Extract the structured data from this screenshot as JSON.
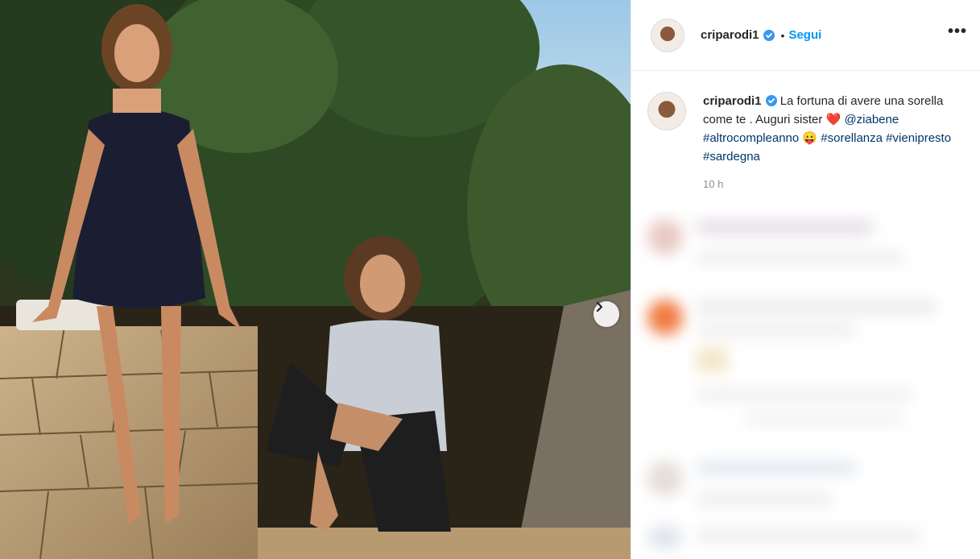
{
  "post": {
    "photo_description_icon": "photo",
    "next_icon": "chevron-right-icon"
  },
  "header": {
    "username": "criparodi1",
    "separator": "•",
    "follow_label": "Segui",
    "more_label": "•••"
  },
  "caption": {
    "username": "criparodi1",
    "text": "La fortuna di avere una sorella come te . Auguri sister",
    "emoji_heart": "❤️",
    "mention": "@ziabene",
    "hashtag_1": "#altrocompleanno",
    "emoji_face": "😛",
    "hashtag_2": "#sorellanza",
    "hashtag_3": "#vienipresto",
    "hashtag_4": "#sardegna",
    "time": "10 h"
  },
  "colors": {
    "link": "#0095f6",
    "hashtag": "#00376b",
    "verified": "#3897f0"
  }
}
